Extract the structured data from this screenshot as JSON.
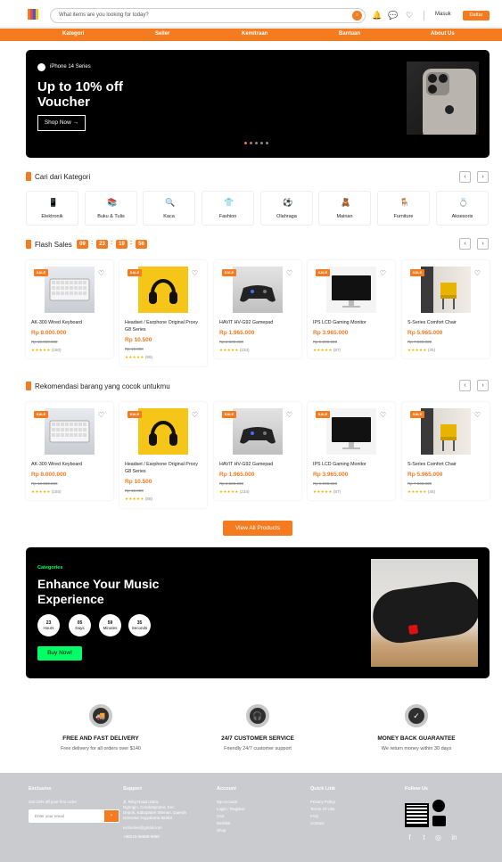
{
  "header": {
    "search_placeholder": "What items are you looking for today?",
    "login_label": "Masuk",
    "register_label": "Daftar",
    "brand_colors": [
      "#f47b20",
      "#e74c3c",
      "#3b5bdb",
      "#f1c40f"
    ]
  },
  "nav": {
    "items": [
      "Kategori",
      "Seller",
      "Kemitraan",
      "Bantuan",
      "About Us"
    ]
  },
  "hero": {
    "series": "iPhone 14 Series",
    "title": "Up to 10% off Voucher",
    "cta": "Shop Now →",
    "active_slide": 1,
    "total_slides": 5
  },
  "categories": {
    "title": "Cari dari Kategori",
    "items": [
      {
        "label": "Elektronik",
        "icon": "phone-icon"
      },
      {
        "label": "Buku & Tulis",
        "icon": "books-icon"
      },
      {
        "label": "Kaca",
        "icon": "magnifier-icon"
      },
      {
        "label": "Fashion",
        "icon": "shirt-icon"
      },
      {
        "label": "Olahraga",
        "icon": "ball-icon"
      },
      {
        "label": "Mainan",
        "icon": "toy-icon"
      },
      {
        "label": "Furniture",
        "icon": "chair-icon"
      },
      {
        "label": "Aksesoris",
        "icon": "ring-icon"
      }
    ]
  },
  "flash_sale": {
    "title": "Flash Sales",
    "timer": [
      "09",
      "23",
      "19",
      "56"
    ],
    "products": [
      {
        "name": "AK-300 Wired Keyboard",
        "price": "Rp 8.000.000",
        "old_price": "Rp 10.000.000",
        "rating_count": "(150)",
        "sale": "SALE",
        "stars": "★★★★★"
      },
      {
        "name": "Headset / Earphone Original Proxy G8 Series",
        "price": "Rp 10.500",
        "old_price": "Rp 15.000",
        "rating_count": "(88)",
        "sale": "SALE",
        "stars": "★★★★★"
      },
      {
        "name": "HAVIT HV-G92 Gamepad",
        "price": "Rp 1.965.000",
        "old_price": "Rp 2.500.000",
        "rating_count": "(234)",
        "sale": "SALE",
        "stars": "★★★★★"
      },
      {
        "name": "IPS LCD Gaming Monitor",
        "price": "Rp 3.965.000",
        "old_price": "Rp 5.000.000",
        "rating_count": "(87)",
        "sale": "SALE",
        "stars": "★★★★★"
      },
      {
        "name": "S-Series Comfort Chair",
        "price": "Rp 5.965.000",
        "old_price": "Rp 7.000.000",
        "rating_count": "(45)",
        "sale": "SALE",
        "stars": "★★★★★"
      }
    ]
  },
  "recommendations": {
    "title": "Rekomendasi barang yang cocok untukmu",
    "products": [
      {
        "name": "AK-300 Wired Keyboard",
        "price": "Rp 8.000.000",
        "old_price": "Rp 10.000.000",
        "rating_count": "(150)",
        "sale": "SALE",
        "stars": "★★★★★"
      },
      {
        "name": "Headset / Earphone Original Proxy G8 Series",
        "price": "Rp 10.500",
        "old_price": "Rp 15.000",
        "rating_count": "(88)",
        "sale": "SALE",
        "stars": "★★★★★"
      },
      {
        "name": "HAVIT HV-G92 Gamepad",
        "price": "Rp 1.965.000",
        "old_price": "Rp 2.500.000",
        "rating_count": "(234)",
        "sale": "SALE",
        "stars": "★★★★★"
      },
      {
        "name": "IPS LCD Gaming Monitor",
        "price": "Rp 3.965.000",
        "old_price": "Rp 5.000.000",
        "rating_count": "(87)",
        "sale": "SALE",
        "stars": "★★★★★"
      },
      {
        "name": "S-Series Comfort Chair",
        "price": "Rp 5.965.000",
        "old_price": "Rp 7.000.000",
        "rating_count": "(45)",
        "sale": "SALE",
        "stars": "★★★★★"
      }
    ],
    "view_all": "View All Products"
  },
  "music": {
    "category": "Categories",
    "title": "Enhance Your Music Experience",
    "countdown": [
      {
        "value": "23",
        "unit": "Hours"
      },
      {
        "value": "05",
        "unit": "Days"
      },
      {
        "value": "59",
        "unit": "Minutes"
      },
      {
        "value": "35",
        "unit": "Seconds"
      }
    ],
    "cta": "Buy Now!"
  },
  "services": [
    {
      "title": "FREE AND FAST DELIVERY",
      "subtitle": "Free delivery for all orders over $140",
      "icon": "truck-icon"
    },
    {
      "title": "24/7 CUSTOMER SERVICE",
      "subtitle": "Friendly 24/7 customer support",
      "icon": "headset-icon"
    },
    {
      "title": "MONEY BACK GUARANTEE",
      "subtitle": "We return money within 30 days",
      "icon": "shield-check-icon"
    }
  ],
  "footer": {
    "exclusive": {
      "title": "Exclusive",
      "text": "Get 10% off your first order",
      "placeholder": "Enter your email"
    },
    "support": {
      "title": "Support",
      "lines": [
        "Jl. Ring Road Utara,",
        "Ngringin, Condongcatur, Kec.",
        "Depok, Kabupaten Sleman, Daerah",
        "Istimewa Yogyakarta 55283"
      ],
      "email": "exclusive@gmail.com",
      "phone": "+88015-88888-9999"
    },
    "account": {
      "title": "Account",
      "links": [
        "My Account",
        "Login / Register",
        "Cart",
        "Wishlist",
        "Shop"
      ]
    },
    "quick_link": {
      "title": "Quick Link",
      "links": [
        "Privacy Policy",
        "Terms Of Use",
        "FAQ",
        "Contact"
      ]
    },
    "follow": {
      "title": "Follow Us"
    }
  }
}
